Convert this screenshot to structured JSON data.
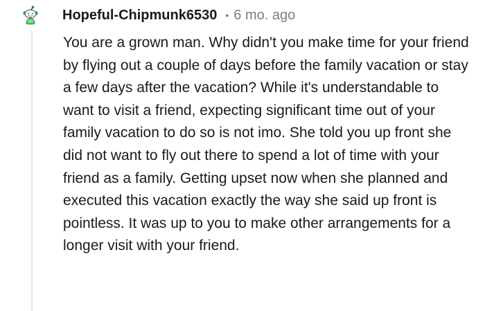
{
  "comment": {
    "username": "Hopeful-Chipmunk6530",
    "separator": "•",
    "timestamp": "6 mo. ago",
    "avatar_icon": "reddit-snoo-avatar-icon",
    "body": "You are a grown man. Why didn't you make time for your friend by flying out a couple of days before the family vacation or stay a few days after the vacation? While it's understandable to want to visit a friend, expecting significant time out of your family vacation to do so is not imo. She told you up front she did not want to fly out there to spend a lot of time with your friend as a family. Getting upset now when she planned and executed this vacation exactly the way she said up front is pointless. It was up to you to make other arrangements for a longer visit with your friend."
  },
  "colors": {
    "text": "#1a1a1b",
    "meta": "#7c7c7c",
    "thread_line": "#e4e6e8",
    "avatar_green": "#46d160"
  }
}
